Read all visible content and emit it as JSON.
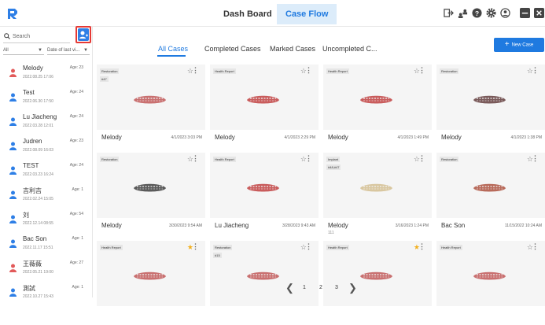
{
  "header": {
    "tabs": [
      {
        "label": "Dash Board",
        "active": false
      },
      {
        "label": "Case Flow",
        "active": true
      }
    ],
    "icons": [
      "logout-icon",
      "users-icon",
      "help-icon",
      "settings-icon",
      "account-icon",
      "minimize-icon",
      "close-icon"
    ]
  },
  "sidebar": {
    "search_placeholder": "Search",
    "filter_left": "All",
    "filter_right": "Date of last vi...",
    "patients": [
      {
        "name": "Melody",
        "date": "2022.08.25 17:06",
        "age": "Age: 23",
        "gender": "female"
      },
      {
        "name": "Test",
        "date": "2022.06.30 17:50",
        "age": "Age: 24",
        "gender": "male"
      },
      {
        "name": "Lu Jiacheng",
        "date": "2022.03.28 12:01",
        "age": "Age: 24",
        "gender": "male"
      },
      {
        "name": "Judren",
        "date": "2022.08.09 16:03",
        "age": "Age: 23",
        "gender": "male"
      },
      {
        "name": "TEST",
        "date": "2022.03.23 16:24",
        "age": "Age: 24",
        "gender": "male"
      },
      {
        "name": "吉利吉",
        "date": "2022.02.24 15:05",
        "age": "Age: 1",
        "gender": "male"
      },
      {
        "name": "刘",
        "date": "2022.12.14 08:55",
        "age": "Age: 54",
        "gender": "male"
      },
      {
        "name": "Bac Son",
        "date": "2022.11.17 15:51",
        "age": "Age: 1",
        "gender": "male"
      },
      {
        "name": "王薇薇",
        "date": "2022.05.21 19:00",
        "age": "Age: 27",
        "gender": "female"
      },
      {
        "name": "測試",
        "date": "2022.10.27 15:43",
        "age": "Age: 1",
        "gender": "male"
      }
    ]
  },
  "case_tabs": [
    {
      "label": "All Cases",
      "active": true
    },
    {
      "label": "Completed Cases",
      "active": false
    },
    {
      "label": "Marked Cases",
      "active": false
    },
    {
      "label": "Uncompleted C...",
      "active": false
    }
  ],
  "new_case_label": "New Case",
  "cases": [
    {
      "badges": [
        "Restoration",
        "#47"
      ],
      "name": "Melody",
      "date": "4/1/2023 3:03 PM",
      "sub": "",
      "starred": false,
      "teeth_color": "#c97070"
    },
    {
      "badges": [
        "Health Report"
      ],
      "name": "Melody",
      "date": "4/1/2023 2:29 PM",
      "sub": "",
      "starred": false,
      "teeth_color": "#c95c5c"
    },
    {
      "badges": [
        "Health Report"
      ],
      "name": "Melody",
      "date": "4/1/2023 1:49 PM",
      "sub": "",
      "starred": false,
      "teeth_color": "#c95c5c"
    },
    {
      "badges": [
        "Restoration"
      ],
      "name": "Melody",
      "date": "4/1/2023 1:38 PM",
      "sub": "",
      "starred": false,
      "teeth_color": "#7a5a5a"
    },
    {
      "badges": [
        "Restoration"
      ],
      "name": "Melody",
      "date": "3/30/2023 9:54 AM",
      "sub": "",
      "starred": false,
      "teeth_color": "#5a5a5a"
    },
    {
      "badges": [
        "Health Report"
      ],
      "name": "Lu Jiacheng",
      "date": "3/28/2023 9:43 AM",
      "sub": "",
      "starred": false,
      "teeth_color": "#c95c5c"
    },
    {
      "badges": [
        "Implant",
        "#48,#47"
      ],
      "name": "Melody",
      "date": "3/16/2023 1:24 PM",
      "sub": "111",
      "starred": false,
      "teeth_color": "#d9c7a0"
    },
    {
      "badges": [
        "Restoration"
      ],
      "name": "Bac Son",
      "date": "11/15/2022 10:24 AM",
      "sub": "",
      "starred": false,
      "teeth_color": "#b86a5a"
    },
    {
      "badges": [
        "Health Report"
      ],
      "name": "",
      "date": "",
      "sub": "",
      "starred": true,
      "teeth_color": "#c97070"
    },
    {
      "badges": [
        "Restoration",
        "#15"
      ],
      "name": "",
      "date": "",
      "sub": "",
      "starred": false,
      "teeth_color": "#c97070"
    },
    {
      "badges": [
        "Health Report"
      ],
      "name": "",
      "date": "",
      "sub": "",
      "starred": true,
      "teeth_color": "#c97070"
    },
    {
      "badges": [
        "Health Report"
      ],
      "name": "",
      "date": "",
      "sub": "",
      "starred": false,
      "teeth_color": "#c97070"
    }
  ],
  "pagination": {
    "pages": [
      "1",
      "2",
      "3"
    ],
    "current": "1"
  },
  "colors": {
    "accent": "#1f7ae0",
    "active_tab_bg": "#dcecfa",
    "highlight_border": "#e53935",
    "female_avatar": "#e25a5a",
    "male_avatar": "#2e7fe6",
    "star_on": "#f2b01e"
  }
}
